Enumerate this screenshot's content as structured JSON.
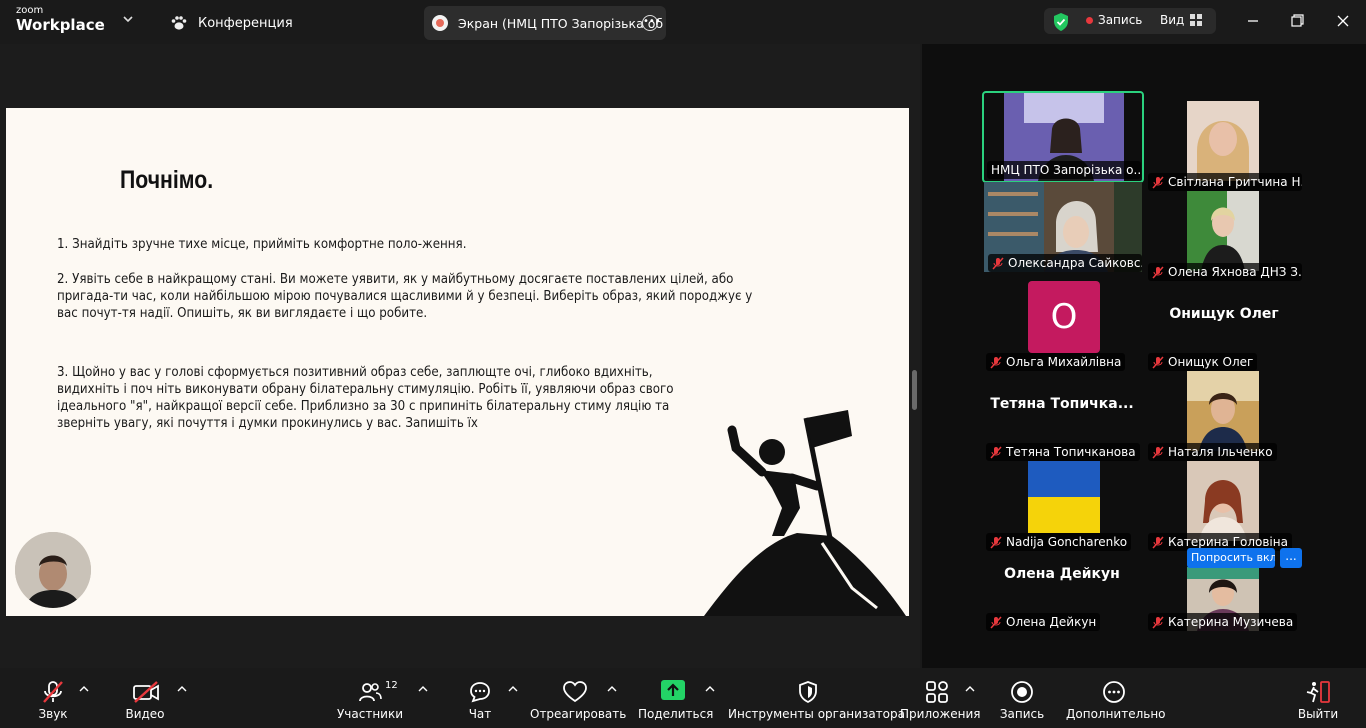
{
  "app": {
    "logo_top": "zoom",
    "logo_bottom": "Workplace"
  },
  "tabs": {
    "conference": "Конференция",
    "screen": "Экран (НМЦ ПТО Запорізька об"
  },
  "header": {
    "record": "Запись",
    "view": "Вид"
  },
  "slide": {
    "title": "Почнімо.",
    "p1": "1. Знайдіть зручне тихе місце, прийміть комфортне поло-ження.",
    "p2a": "2. Уявіть себе в найкращому стані. Ви можете уявити, як у майбутньому досягаєте поставлених цілей, або",
    "p2b": "пригада-ти час, коли найбільшою мірою почувалися щасливими й у безпеці. Виберіть образ, який породжує у",
    "p2c": "вас почут-тя надії. Опишіть, як ви виглядаєте і що робите.",
    "p3a": "3. Щойно у вас у голові сформується позитивний образ себе, заплющте очі, глибоко вдихніть,",
    "p3b": "видихніть і поч ніть виконувати обрану білатеральну стимуляцію. Робіть її, уявляючи образ свого",
    "p3c": "ідеального \"я\", найкращої версії себе. Приблизно за 30 с припиніть білатеральну стиму ляцію та",
    "p3d": "зверніть увагу, які почуття і думки прокинулись у вас. Запишіть їх"
  },
  "participants": [
    {
      "name": "НМЦ ПТО Запорізька о...",
      "muted": false,
      "kind": "video",
      "active": true
    },
    {
      "name": "Світлана Гритчина Н...",
      "muted": true,
      "kind": "video"
    },
    {
      "name": "Олександра Сайковс...",
      "muted": true,
      "kind": "video"
    },
    {
      "name": "Олена Яхнова ДНЗ З...",
      "muted": true,
      "kind": "video"
    },
    {
      "name": "Ольга Михайлівна",
      "muted": true,
      "kind": "avatar",
      "initial": "О"
    },
    {
      "name": "Онищук Олег",
      "muted": true,
      "kind": "name",
      "big": "Онищук Олег"
    },
    {
      "name": "Тетяна Топичканова",
      "muted": true,
      "kind": "name",
      "big": "Тетяна  Топичка..."
    },
    {
      "name": "Наталя Ільченко",
      "muted": true,
      "kind": "video"
    },
    {
      "name": "Nadija Goncharenko",
      "muted": true,
      "kind": "flag"
    },
    {
      "name": "Катерина Головіна",
      "muted": true,
      "kind": "video"
    },
    {
      "name": "Олена Дейкун",
      "muted": true,
      "kind": "name",
      "big": "Олена Дейкун"
    },
    {
      "name": "Катерина Музичева",
      "muted": true,
      "kind": "video"
    }
  ],
  "ask_button": "Попросить вкл",
  "more_button": "...",
  "toolbar": {
    "audio": "Звук",
    "video": "Видео",
    "participants": "Участники",
    "participants_count": "12",
    "chat": "Чат",
    "react": "Отреагировать",
    "share": "Поделиться",
    "host_tools": "Инструменты организатора",
    "apps": "Приложения",
    "record": "Запись",
    "more": "Дополнительно",
    "leave": "Выйти"
  },
  "colors": {
    "active_border": "#2bd17e",
    "share_green": "#23d366",
    "record_red": "#e8383d",
    "blue": "#0e72ed"
  }
}
